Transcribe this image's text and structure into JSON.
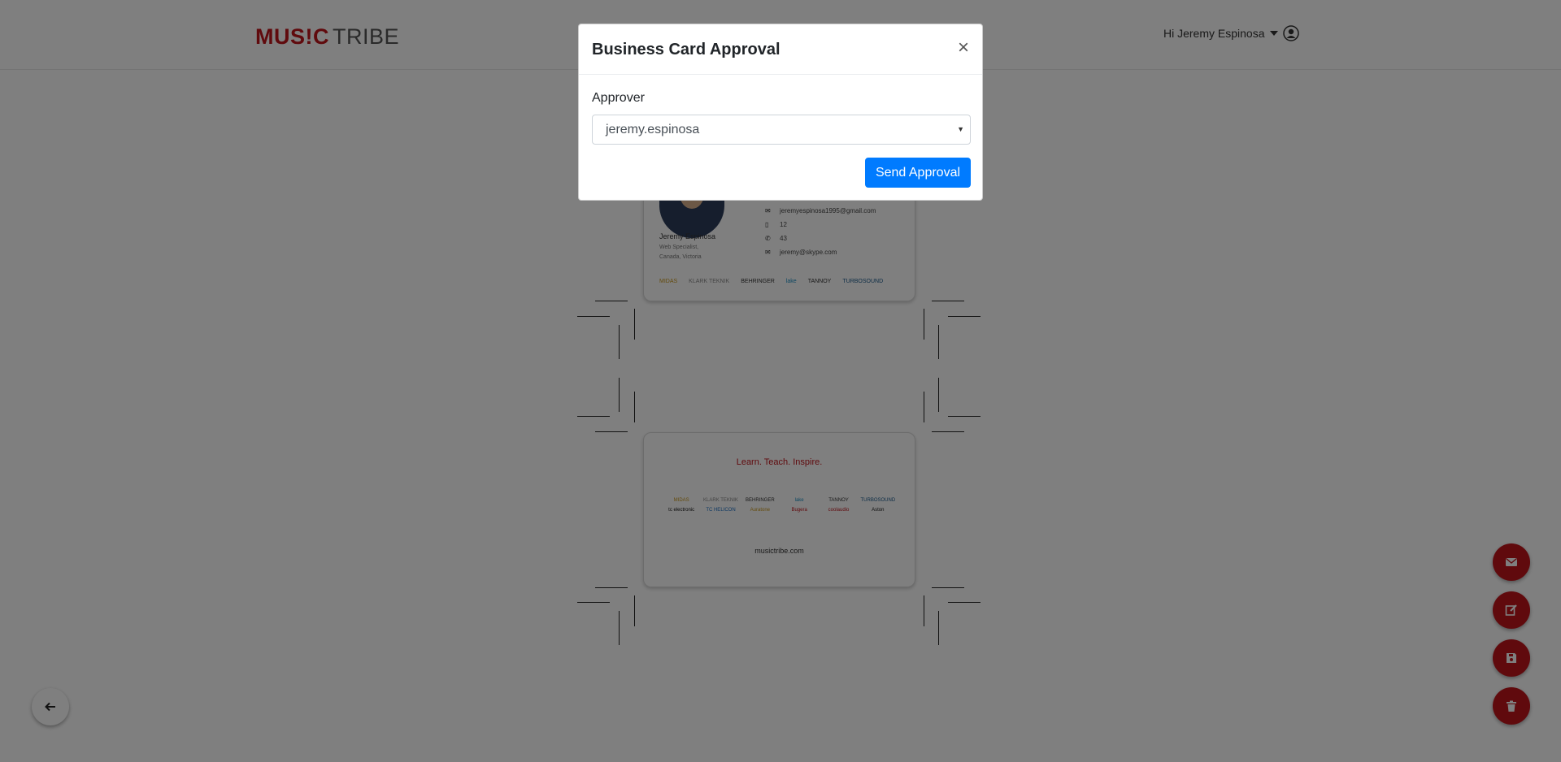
{
  "header": {
    "logo_music": "MUS!C",
    "logo_tribe": "TRIBE",
    "greeting": "Hi Jeremy Espinosa"
  },
  "card_front": {
    "name": "Jeremy Espinosa",
    "title": "Web Specialist,",
    "location": "Canada, Victoria",
    "contacts": [
      {
        "icon": "envelope-icon",
        "value": "jeremyespinosa1995@gmail.com"
      },
      {
        "icon": "mobile-icon",
        "value": "12"
      },
      {
        "icon": "phone-icon",
        "value": "43"
      },
      {
        "icon": "skype-icon",
        "value": "jeremy@skype.com"
      }
    ],
    "brands": [
      "MIDAS",
      "KLARK TEKNIK",
      "BEHRINGER",
      "lake",
      "TANNOY",
      "TURBOSOUND"
    ]
  },
  "card_back": {
    "tagline": "Learn. Teach. Inspire.",
    "brands": [
      "MIDAS",
      "KLARK TEKNIK",
      "BEHRINGER",
      "lake",
      "TANNOY",
      "TURBOSOUND",
      "tc electronic",
      "TC HELICON",
      "Auratone",
      "Bugera",
      "coolaudio",
      "Aston"
    ],
    "website": "musictribe.com"
  },
  "modal": {
    "title": "Business Card Approval",
    "close": "×",
    "approver_label": "Approver",
    "approver_value": "jeremy.espinosa",
    "send_label": "Send Approval"
  },
  "colors": {
    "brand_red": "#c0141b",
    "primary_blue": "#007bff"
  },
  "fabs": [
    "envelope-icon",
    "edit-icon",
    "save-icon",
    "trash-icon"
  ],
  "back_icon": "arrow-left-icon"
}
